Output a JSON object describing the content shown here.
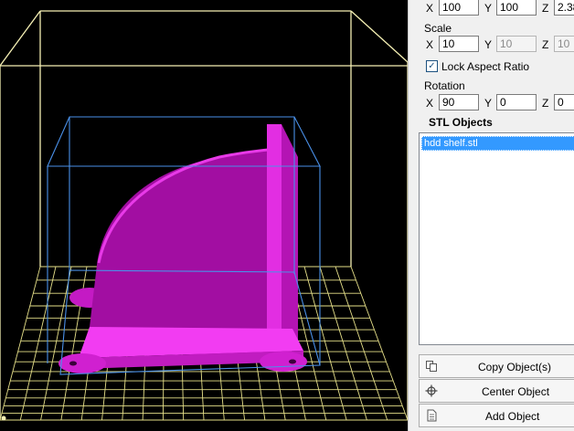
{
  "position": {
    "x_axis": "X",
    "x_value": "100",
    "y_axis": "Y",
    "y_value": "100",
    "z_axis": "Z",
    "z_value": "2.38"
  },
  "scale": {
    "heading": "Scale",
    "x_axis": "X",
    "x_value": "10",
    "y_axis": "Y",
    "y_value": "10",
    "z_axis": "Z",
    "z_value": "10"
  },
  "lock_aspect": {
    "label": "Lock Aspect Ratio",
    "checked": true
  },
  "rotation": {
    "heading": "Rotation",
    "x_axis": "X",
    "x_value": "90",
    "y_axis": "Y",
    "y_value": "0",
    "z_axis": "Z",
    "z_value": "0"
  },
  "stl_objects": {
    "heading": "STL Objects",
    "items": [
      "hdd shelf.stl"
    ]
  },
  "buttons": {
    "copy": "Copy Object(s)",
    "center": "Center Object",
    "add": "Add Object"
  },
  "icons": {
    "copy": "copy-icon",
    "center": "crosshair-icon",
    "add": "document-icon"
  },
  "colors": {
    "viewport_bg": "#000000",
    "build_volume": "#f5f0b4",
    "platform_grid": "#e6e089",
    "bounding_box": "#4a90e8",
    "model": "#d21ed2",
    "selection": "#3399ff"
  }
}
